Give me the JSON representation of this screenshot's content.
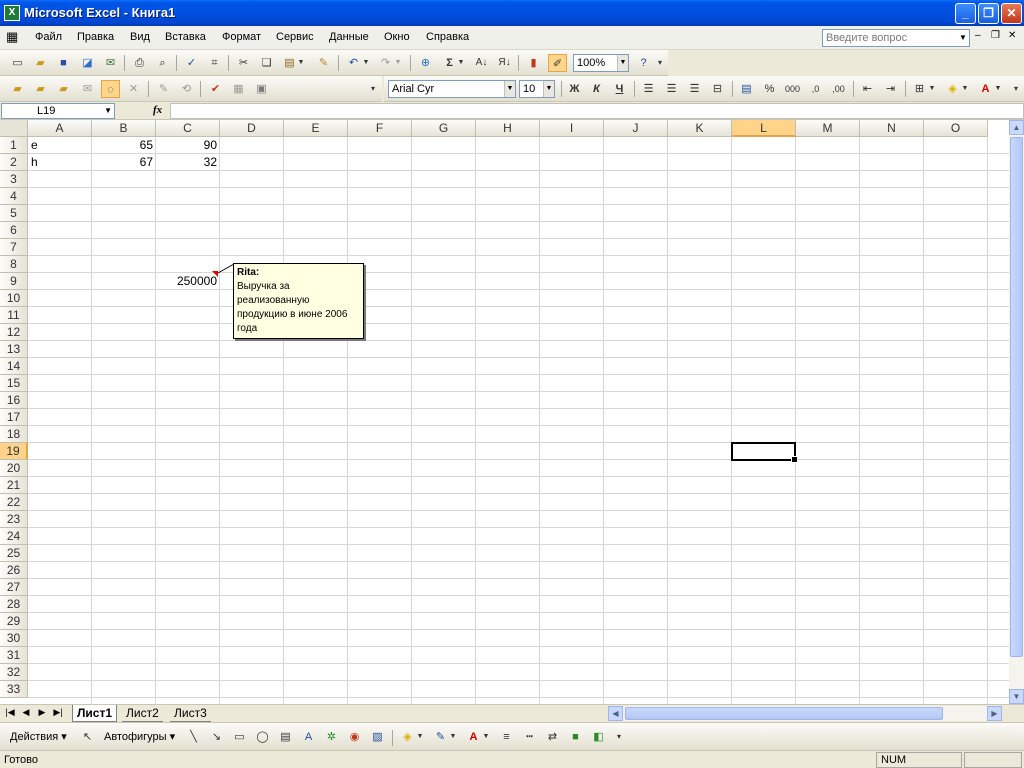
{
  "window": {
    "title": "Microsoft Excel - Книга1",
    "app_icon": "X"
  },
  "menu": {
    "items": [
      "Файл",
      "Правка",
      "Вид",
      "Вставка",
      "Формат",
      "Сервис",
      "Данные",
      "Окно",
      "Справка"
    ],
    "ask_placeholder": "Введите вопрос"
  },
  "standard_toolbar": {
    "zoom": "100%"
  },
  "formatting_toolbar": {
    "font": "Arial Cyr",
    "size": "10",
    "bold": "Ж",
    "italic": "К",
    "underline": "Ч",
    "percent": "%",
    "thousands": "000"
  },
  "formula_bar": {
    "name_box": "L19",
    "fx": "fx",
    "content": ""
  },
  "grid": {
    "columns": [
      "A",
      "B",
      "C",
      "D",
      "E",
      "F",
      "G",
      "H",
      "I",
      "J",
      "K",
      "L",
      "M",
      "N",
      "O"
    ],
    "selected_column": "L",
    "rows": [
      "1",
      "2",
      "3",
      "4",
      "5",
      "6",
      "7",
      "8",
      "9",
      "10",
      "11",
      "12",
      "13",
      "14",
      "15",
      "16",
      "17",
      "18",
      "19",
      "20",
      "21",
      "22",
      "23",
      "24",
      "25",
      "26",
      "27",
      "28",
      "29",
      "30",
      "31",
      "32",
      "33"
    ],
    "selected_row": "19",
    "cells": {
      "A1": "e",
      "B1": "65",
      "C1": "90",
      "A2": "h",
      "B2": "67",
      "C2": "32",
      "C9": "250000"
    }
  },
  "comment": {
    "author": "Rita:",
    "text": "Выручка за реализованную продукцию в июне 2006 года"
  },
  "sheets": {
    "tabs": [
      "Лист1",
      "Лист2",
      "Лист3"
    ],
    "active": "Лист1"
  },
  "drawing_toolbar": {
    "actions": "Действия",
    "autoshapes": "Автофигуры"
  },
  "status": {
    "text": "Готово",
    "num": "NUM"
  },
  "colors": {
    "title_bar": "#0054e3",
    "selection_header": "#ffd38a",
    "comment_bg": "#ffffe1"
  }
}
